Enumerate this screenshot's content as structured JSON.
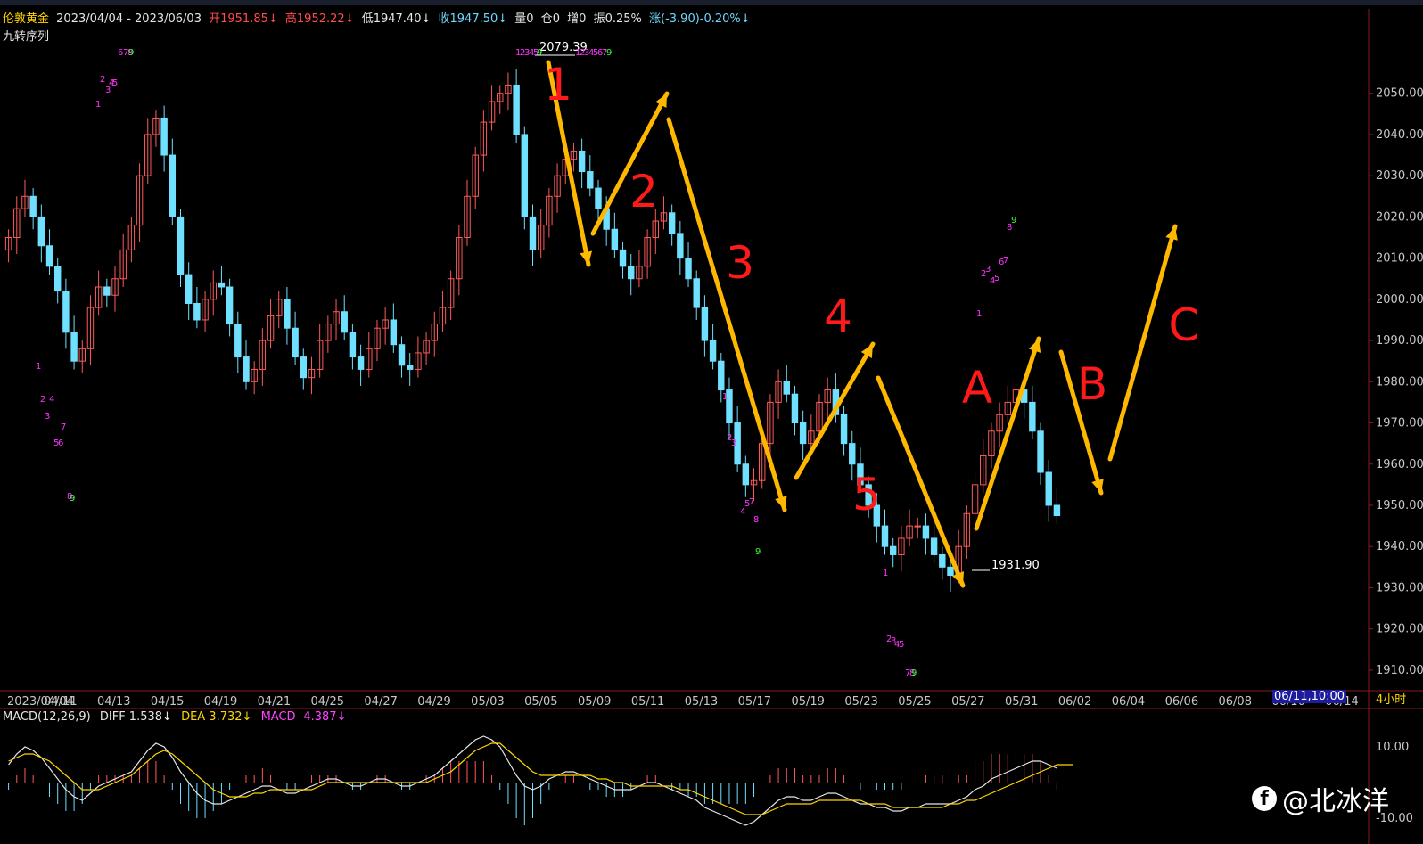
{
  "header": {
    "symbol": "伦敦黄金",
    "date_range": "2023/04/04 - 2023/06/03",
    "open": "开1951.85↓",
    "high": "高1952.22↓",
    "low": "低1947.40↓",
    "close": "收1947.50↓",
    "volume": "量0",
    "position": "仓0",
    "increase": "增0",
    "amplitude": "振0.25%",
    "change": "涨(-3.90)-0.20%↓"
  },
  "indicator_name": "九转序列",
  "timeframe": "4小时",
  "cursor_date": "06/11,10:00",
  "watermark": "@北冰洋",
  "macd": {
    "title": "MACD(12,26,9)",
    "diff": "DIFF 1.538↓",
    "dea": "DEA 3.732↓",
    "macd": "MACD -4.387↓",
    "y_ticks": [
      "10.00",
      "-10.00"
    ]
  },
  "annotations": {
    "peak_label": "2079.39",
    "trough_label": "1931.90",
    "wave_labels": [
      "1",
      "2",
      "3",
      "4",
      "5",
      "A",
      "B",
      "C"
    ]
  },
  "colors": {
    "up": "#ff5a5a",
    "down": "#6fe0ff",
    "arrow": "#ffb800",
    "wave_label": "#ff1a1a",
    "seq": "#ff33ff",
    "seq9": "#33ff33"
  },
  "chart_data": {
    "type": "candlestick",
    "title": "伦敦黄金",
    "x_ticks": [
      "2023/04/04",
      "04/11",
      "04/13",
      "04/15",
      "04/19",
      "04/21",
      "04/25",
      "04/27",
      "04/29",
      "05/03",
      "05/05",
      "05/09",
      "05/11",
      "05/13",
      "05/17",
      "05/19",
      "05/23",
      "05/25",
      "05/27",
      "05/31",
      "06/02",
      "06/04",
      "06/06",
      "06/08",
      "06/10",
      "06/14"
    ],
    "y_ticks": [
      "2050.00",
      "2040.00",
      "2030.00",
      "2020.00",
      "2010.00",
      "2000.00",
      "1990.00",
      "1980.00",
      "1970.00",
      "1960.00",
      "1950.00",
      "1940.00",
      "1930.00",
      "1920.00",
      "1910.00"
    ],
    "ylim": [
      1905,
      2064
    ],
    "closes": [
      2015,
      2022,
      2025,
      2020,
      2013,
      2008,
      2002,
      1992,
      1985,
      1988,
      1998,
      2003,
      2001,
      2005,
      2012,
      2018,
      2030,
      2040,
      2044,
      2035,
      2020,
      2006,
      1999,
      1995,
      2000,
      2004,
      2003,
      1994,
      1986,
      1980,
      1983,
      1990,
      1996,
      2000,
      1993,
      1986,
      1981,
      1983,
      1990,
      1994,
      1997,
      1992,
      1986,
      1983,
      1988,
      1993,
      1995,
      1989,
      1984,
      1983,
      1987,
      1990,
      1994,
      1998,
      2005,
      2015,
      2025,
      2035,
      2043,
      2048,
      2050,
      2052,
      2040,
      2020,
      2012,
      2018,
      2025,
      2030,
      2034,
      2036,
      2031,
      2027,
      2022,
      2017,
      2012,
      2008,
      2005,
      2008,
      2015,
      2019,
      2021,
      2016,
      2010,
      2005,
      1998,
      1990,
      1985,
      1978,
      1970,
      1960,
      1955,
      1956,
      1965,
      1975,
      1980,
      1977,
      1970,
      1965,
      1968,
      1975,
      1978,
      1972,
      1965,
      1960,
      1955,
      1950,
      1945,
      1940,
      1938,
      1942,
      1945,
      1945,
      1942,
      1938,
      1935,
      1933,
      1940,
      1948,
      1955,
      1962,
      1968,
      1972,
      1975,
      1978,
      1975,
      1968,
      1958,
      1950,
      1947.5
    ],
    "peak": {
      "value": 2079.39,
      "label": "2079.39"
    },
    "trough": {
      "value": 1931.9,
      "label": "1931.90"
    },
    "macd_series": {
      "diff": [
        5,
        8,
        10,
        9,
        7,
        4,
        1,
        -2,
        -4,
        -5,
        -3,
        -1,
        0,
        1,
        2,
        3,
        6,
        9,
        11,
        10,
        7,
        3,
        0,
        -3,
        -5,
        -6,
        -6,
        -5,
        -4,
        -3,
        -2,
        -1,
        -1,
        -2,
        -3,
        -3,
        -2,
        -1,
        0,
        1,
        1,
        0,
        -1,
        -1,
        0,
        1,
        1,
        0,
        -1,
        -1,
        0,
        1,
        2,
        4,
        6,
        8,
        10,
        12,
        13,
        12,
        10,
        6,
        2,
        -1,
        -2,
        -1,
        1,
        2,
        3,
        3,
        2,
        1,
        0,
        -1,
        -2,
        -2,
        -2,
        -1,
        0,
        0,
        -1,
        -2,
        -3,
        -4,
        -5,
        -7,
        -8,
        -9,
        -10,
        -11,
        -12,
        -11,
        -9,
        -7,
        -5,
        -4,
        -4,
        -5,
        -5,
        -4,
        -3,
        -3,
        -4,
        -5,
        -6,
        -6,
        -7,
        -7,
        -8,
        -8,
        -7,
        -7,
        -6,
        -6,
        -6,
        -6,
        -5,
        -4,
        -2,
        -1,
        1,
        2,
        3,
        4,
        5,
        6,
        6,
        5,
        4
      ],
      "dea": [
        6,
        7,
        8,
        8,
        7,
        6,
        4,
        2,
        0,
        -2,
        -2,
        -2,
        -1,
        0,
        1,
        2,
        4,
        6,
        8,
        9,
        8,
        6,
        4,
        2,
        0,
        -2,
        -3,
        -4,
        -4,
        -4,
        -3,
        -3,
        -2,
        -2,
        -2,
        -2,
        -2,
        -2,
        -1,
        0,
        0,
        0,
        0,
        0,
        0,
        0,
        0,
        0,
        0,
        0,
        0,
        0,
        1,
        2,
        3,
        5,
        7,
        9,
        10,
        11,
        11,
        9,
        7,
        5,
        3,
        2,
        2,
        2,
        2,
        2,
        2,
        2,
        1,
        1,
        0,
        0,
        -1,
        -1,
        -1,
        -1,
        -1,
        -1,
        -2,
        -2,
        -3,
        -4,
        -5,
        -6,
        -7,
        -8,
        -9,
        -9,
        -9,
        -8,
        -7,
        -6,
        -6,
        -6,
        -6,
        -5,
        -5,
        -5,
        -5,
        -5,
        -5,
        -6,
        -6,
        -6,
        -7,
        -7,
        -7,
        -7,
        -7,
        -7,
        -7,
        -6,
        -6,
        -5,
        -5,
        -4,
        -3,
        -2,
        -1,
        0,
        1,
        2,
        3,
        4,
        5,
        5,
        5
      ]
    }
  }
}
